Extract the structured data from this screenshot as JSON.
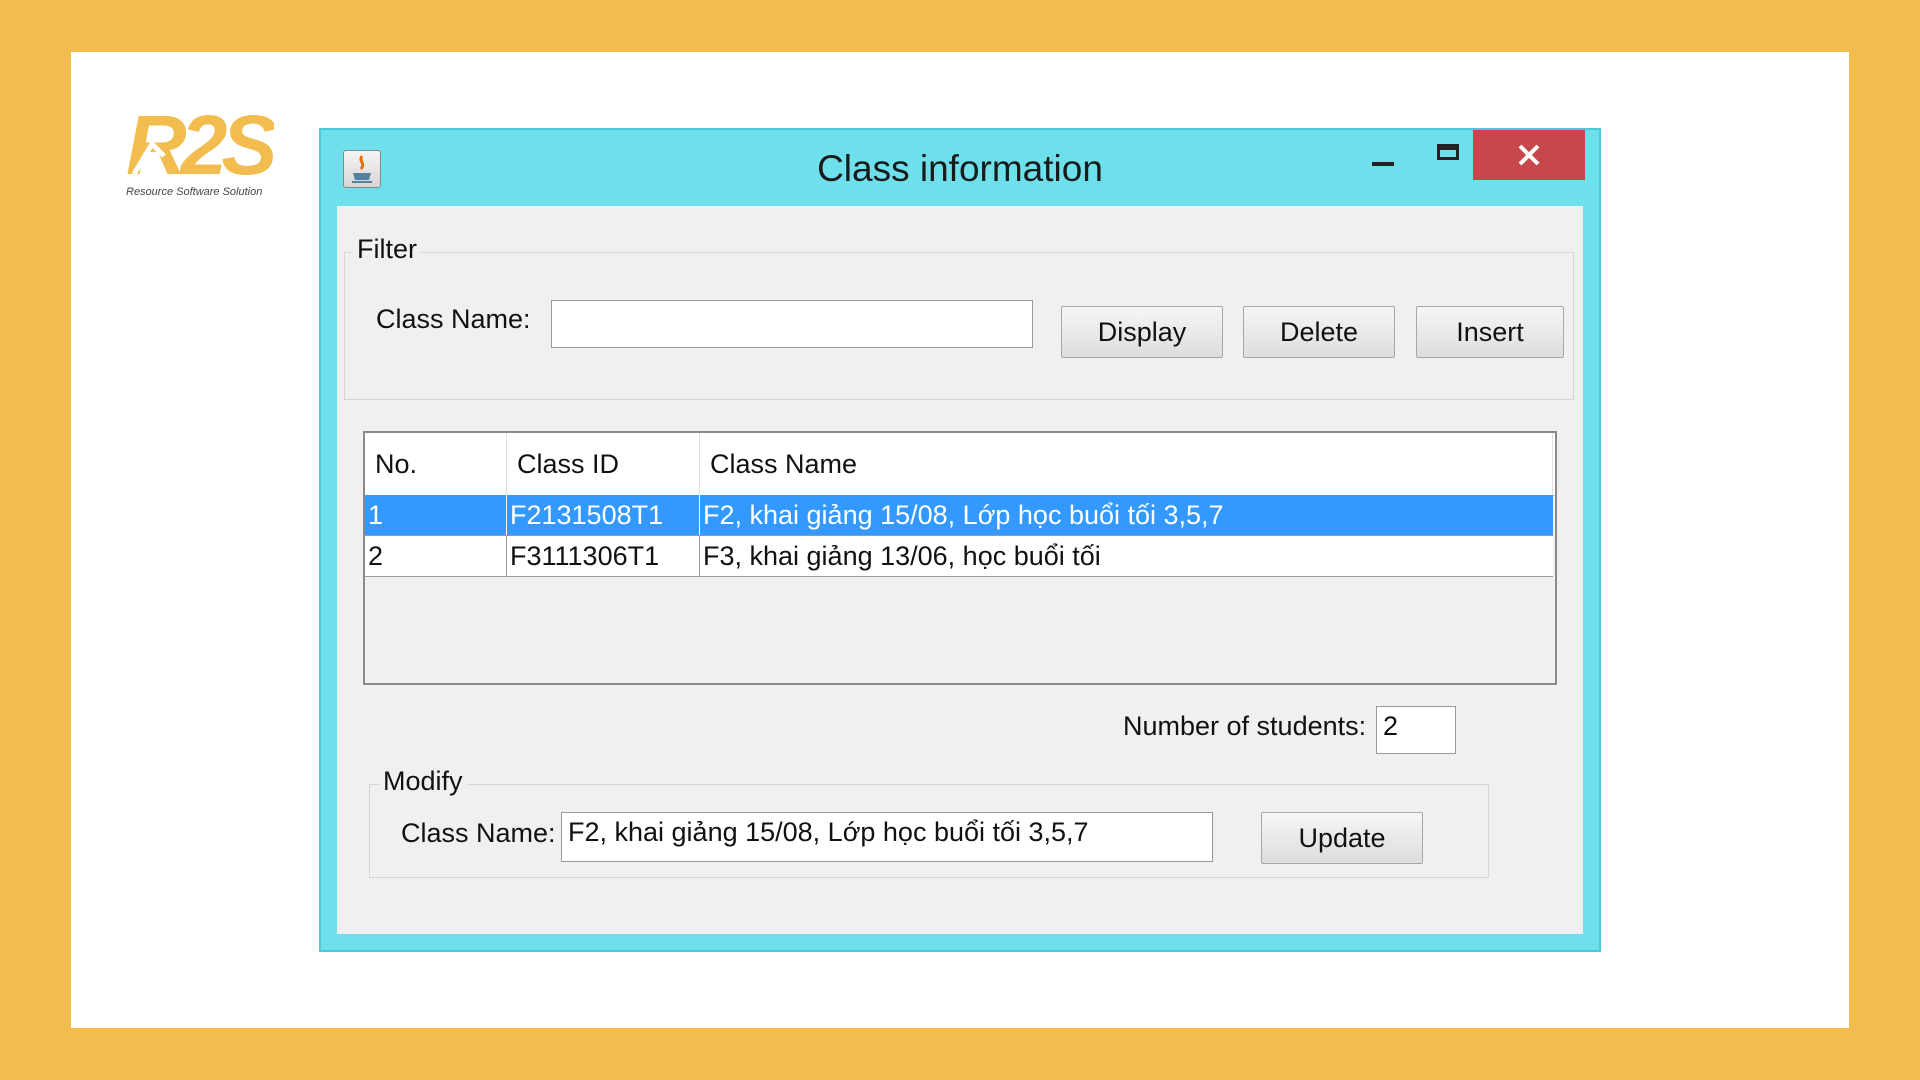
{
  "logo": {
    "mark_text": "R2S",
    "tagline": "Resource Software Solution"
  },
  "window": {
    "title": "Class information",
    "controls": [
      "minimize-icon",
      "maximize-icon",
      "close-icon"
    ]
  },
  "filter": {
    "legend": "Filter",
    "class_name_label": "Class Name:",
    "class_name_value": "",
    "buttons": {
      "display": "Display",
      "delete": "Delete",
      "insert": "Insert"
    }
  },
  "table": {
    "columns": [
      "No.",
      "Class ID",
      "Class Name"
    ],
    "rows": [
      {
        "no": "1",
        "class_id": "F2131508T1",
        "class_name": "F2, khai giảng 15/08, Lớp học buổi tối 3,5,7",
        "selected": true
      },
      {
        "no": "2",
        "class_id": "F3111306T1",
        "class_name": "F3, khai giảng 13/06, học buổi tối",
        "selected": false
      }
    ]
  },
  "students": {
    "label": "Number of students:",
    "value": "2"
  },
  "modify": {
    "legend": "Modify",
    "class_name_label": "Class Name:",
    "class_name_value": "F2, khai giảng 15/08, Lớp học buổi tối 3,5,7",
    "update_label": "Update"
  },
  "colors": {
    "background": "#f2bc4e",
    "title_bar": "#6ee0ec",
    "close_button": "#c8474a",
    "selection": "#3399ff",
    "logo": "#f2bc4e"
  }
}
